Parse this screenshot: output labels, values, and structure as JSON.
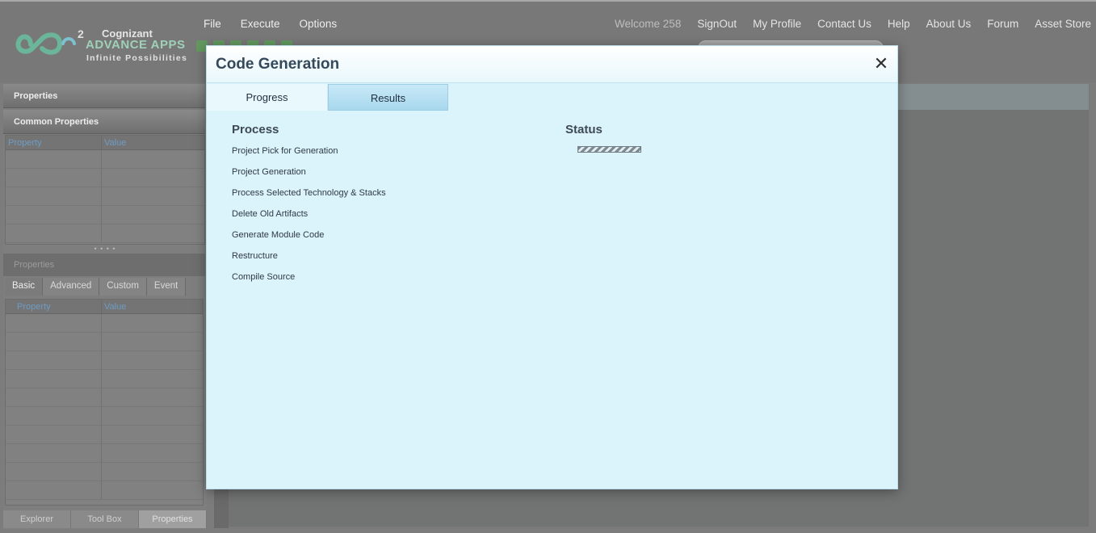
{
  "logo": {
    "brand": "Cognizant",
    "superscript": "2",
    "product": "ADVANCE APPS",
    "tagline": "Infinite  Possibilities"
  },
  "menu": [
    "File",
    "Execute",
    "Options"
  ],
  "topnav": {
    "welcome": "Welcome  258",
    "links": [
      "SignOut",
      "My Profile",
      "Contact Us",
      "Help",
      "About Us",
      "Forum",
      "Asset Store"
    ]
  },
  "left_panel": {
    "properties_title": "Properties",
    "common_properties_title": "Common Properties",
    "grid_headers": [
      "Property",
      "Value"
    ],
    "splitter": "• • • •",
    "second_title": "Properties",
    "tabs": [
      "Basic",
      "Advanced",
      "Custom",
      "Event"
    ],
    "active_tab": "Basic",
    "bottom_tabs": [
      "Explorer",
      "Tool Box",
      "Properties"
    ],
    "active_bottom_tab": "Properties"
  },
  "modal": {
    "title": "Code Generation",
    "close_glyph": "✕",
    "tabs": [
      "Progress",
      "Results"
    ],
    "active_tab": "Progress",
    "process_heading": "Process",
    "status_heading": "Status",
    "process_steps": [
      "Project Pick for Generation",
      "Project Generation",
      "Process Selected Technology & Stacks",
      "Delete Old Artifacts",
      "Generate Module Code",
      "Restructure",
      "Compile Source"
    ],
    "status_indicator": "indeterminate-progress"
  },
  "colors": {
    "modal_bg": "#dbf3fb",
    "overlay": "#7c7c7c",
    "tab_inactive": "#a9d8ee",
    "grid_header_text": "#6e9cc4"
  }
}
